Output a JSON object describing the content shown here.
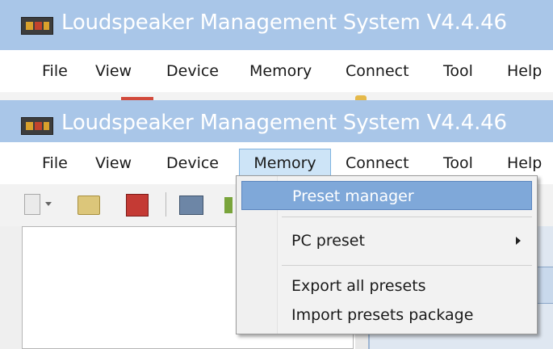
{
  "window_back": {
    "title": "Loudspeaker Management System V4.4.46",
    "menu": [
      "File",
      "View",
      "Device",
      "Memory",
      "Connect",
      "Tool",
      "Help"
    ]
  },
  "window_front": {
    "title": "Loudspeaker Management System V4.4.46",
    "menu": [
      "File",
      "View",
      "Device",
      "Memory",
      "Connect",
      "Tool",
      "Help"
    ],
    "active_menu": "Memory"
  },
  "memory_menu": {
    "items": [
      {
        "label": "Preset manager",
        "highlighted": true
      },
      {
        "label": "PC preset",
        "has_submenu": true
      },
      {
        "label": "Export all presets"
      },
      {
        "label": "Import presets package"
      }
    ]
  },
  "colors": {
    "titlebar": "#a9c6e8",
    "highlight": "#7fa8d9",
    "menu_active": "#cde4f7"
  }
}
